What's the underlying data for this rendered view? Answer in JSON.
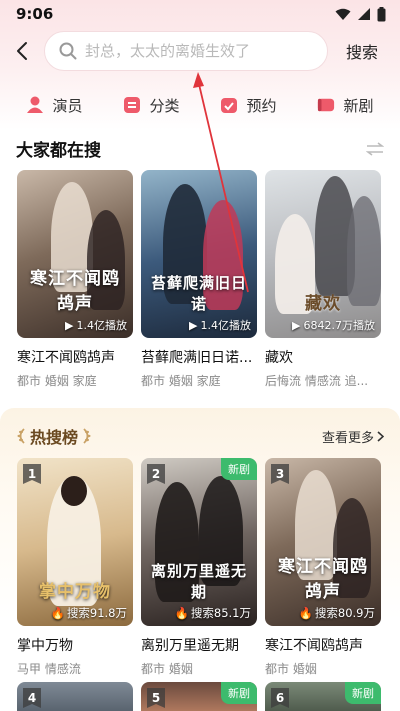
{
  "status": {
    "time": "9:06"
  },
  "header": {
    "search_placeholder": "封总，太太的离婚生效了",
    "search_button": "搜索"
  },
  "categories": [
    {
      "label": "演员",
      "icon": "actor-icon",
      "color": "#ee5a6a"
    },
    {
      "label": "分类",
      "icon": "category-icon",
      "color": "#ee5a6a"
    },
    {
      "label": "预约",
      "icon": "reserve-icon",
      "color": "#ee5a6a"
    },
    {
      "label": "新剧",
      "icon": "new-drama-icon",
      "color": "#ee5a6a"
    }
  ],
  "popular": {
    "title": "大家都在搜",
    "items": [
      {
        "name": "寒江不闻鸥鸪声",
        "tags": "都市 婚姻 家庭",
        "plays": "1.4亿播放",
        "poster_title": "寒江不闻鸥鸪声"
      },
      {
        "name": "苔藓爬满旧日诺...",
        "tags": "都市 婚姻 家庭",
        "plays": "1.4亿播放",
        "poster_title": "苔藓爬满旧日诺"
      },
      {
        "name": "藏欢",
        "tags": "后悔流 情感流 追...",
        "plays": "6842.7万播放",
        "poster_title": "藏欢"
      }
    ]
  },
  "hot": {
    "title": "热搜榜",
    "more": "查看更多",
    "new_badge": "新剧",
    "items": [
      {
        "rank": "1",
        "name": "掌中万物",
        "tags": "马甲 情感流",
        "score": "搜索91.8万",
        "poster_title": "掌中万物",
        "is_new": false
      },
      {
        "rank": "2",
        "name": "离别万里遥无期",
        "tags": "都市 婚姻",
        "score": "搜索85.1万",
        "poster_title": "离别万里遥无期",
        "is_new": true
      },
      {
        "rank": "3",
        "name": "寒江不闻鸥鸪声",
        "tags": "都市 婚姻",
        "score": "搜索80.9万",
        "poster_title": "寒江不闻鸥鸪声",
        "is_new": false
      }
    ],
    "next_ranks": [
      "4",
      "5",
      "6"
    ]
  },
  "colors": {
    "accent": "#ee5a6a",
    "hot_title": "#6b4a21",
    "new_badge": "#3dbb6d"
  }
}
